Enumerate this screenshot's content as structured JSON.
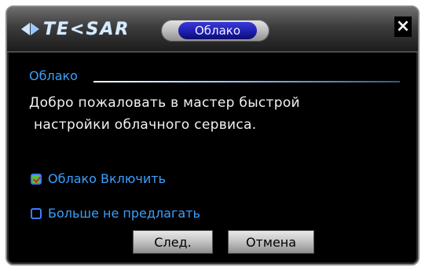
{
  "window": {
    "brand": "TE<SAR",
    "tab_label": "Облако",
    "close_glyph": "×"
  },
  "content": {
    "section_title": "Облако",
    "welcome_line1": "Добро пожаловать в мастер быстрой",
    "welcome_line2": "настройки облачного сервиса."
  },
  "options": {
    "enable_cloud": {
      "label": "Облако Включить",
      "checked": true
    },
    "dont_offer": {
      "label": "Больше не предлагать",
      "checked": false
    }
  },
  "buttons": {
    "next": "След.",
    "cancel": "Отмена"
  },
  "colors": {
    "accent_text": "#3aa0ff",
    "tab_pill": "#1f1fb0",
    "background": "#000000"
  }
}
